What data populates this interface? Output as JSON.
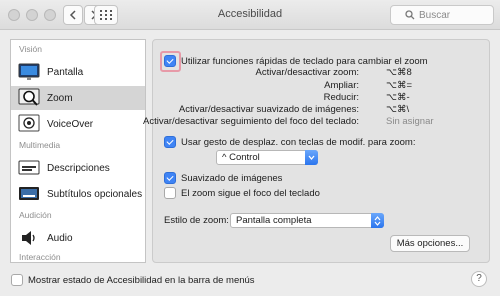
{
  "window": {
    "title": "Accesibilidad"
  },
  "search": {
    "placeholder": "Buscar"
  },
  "sidebar": {
    "sections": {
      "vision": "Visión",
      "media": "Multimedia",
      "hearing": "Audición",
      "interaction": "Interacción"
    },
    "items": [
      {
        "label": "Pantalla"
      },
      {
        "label": "Zoom",
        "selected": true
      },
      {
        "label": "VoiceOver"
      },
      {
        "label": "Descripciones"
      },
      {
        "label": "Subtítulos opcionales"
      },
      {
        "label": "Audio"
      }
    ]
  },
  "zoom": {
    "keyboard_shortcuts": {
      "label": "Utilizar funciones rápidas de teclado para cambiar el zoom",
      "checked": true
    },
    "shortcuts": [
      {
        "label": "Activar/desactivar zoom:",
        "value": "⌥⌘8"
      },
      {
        "label": "Ampliar:",
        "value": "⌥⌘="
      },
      {
        "label": "Reducir:",
        "value": "⌥⌘-"
      },
      {
        "label": "Activar/desactivar suavizado de imágenes:",
        "value": "⌥⌘\\"
      },
      {
        "label": "Activar/desactivar seguimiento del foco del teclado:",
        "value": "Sin asignar"
      }
    ],
    "scroll_gesture": {
      "label": "Usar gesto de desplaz. con teclas de modif. para zoom:",
      "checked": true
    },
    "modifier": {
      "value": "^ Control"
    },
    "smooth_images": {
      "label": "Suavizado de imágenes",
      "checked": true
    },
    "follow_focus": {
      "label": "El zoom sigue el foco del teclado",
      "checked": false
    },
    "style": {
      "label": "Estilo de zoom:",
      "value": "Pantalla completa"
    },
    "more_options": "Más opciones..."
  },
  "footer": {
    "show_status_label": "Mostrar estado de Accesibilidad en la barra de menús",
    "checked": false,
    "help": "?"
  },
  "colors": {
    "accent": "#3f84f5",
    "selection": "#d5d5d5"
  }
}
